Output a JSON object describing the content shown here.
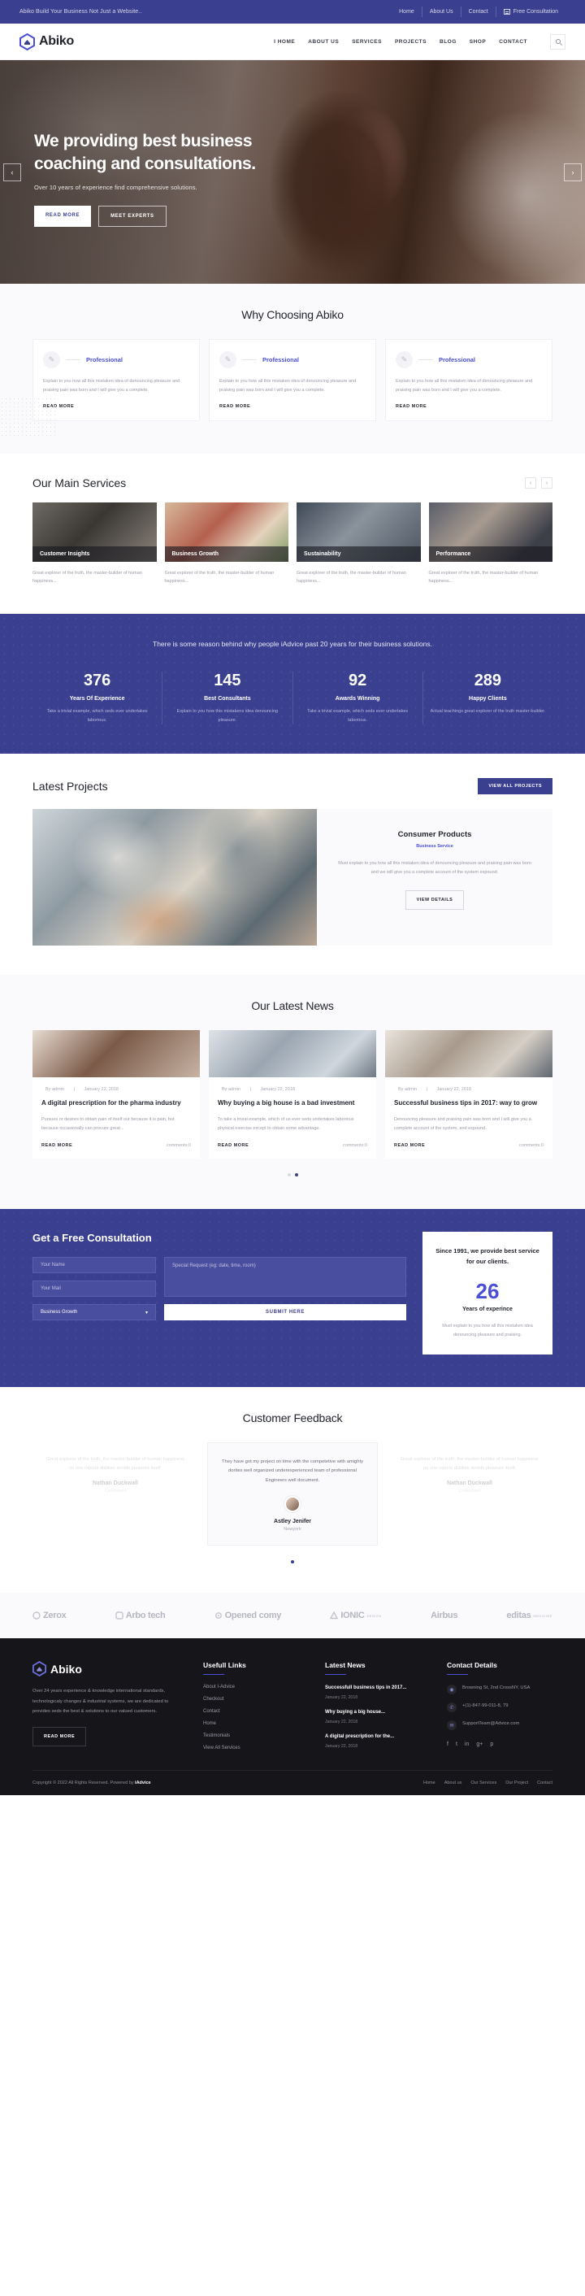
{
  "topbar": {
    "tagline": "Abiko Build Your Business Not Just a Website..",
    "links": [
      "Home",
      "About Us",
      "Contact"
    ],
    "cta": "Free Consultation"
  },
  "header": {
    "brand": "Abiko",
    "nav": [
      "I HOME",
      "ABOUT US",
      "SERVICES",
      "PROJECTS",
      "BLOG",
      "SHOP",
      "CONTACT"
    ],
    "search_icon": "search-icon"
  },
  "hero": {
    "title": "We providing best business coaching and consultations.",
    "subtitle": "Over 10 years of experience find comprehensive solutions.",
    "btn_primary": "READ MORE",
    "btn_secondary": "MEET EXPERTS",
    "arrow_prev": "‹",
    "arrow_next": "›"
  },
  "why": {
    "heading": "Why Choosing Abiko",
    "cards": [
      {
        "title": "Professional",
        "body": "Explain to you how all this mistaken idea of denouncing pleasure and praising pain was born and I will give you a complete.",
        "more": "READ MORE"
      },
      {
        "title": "Professional",
        "body": "Explain to you how all this mistaken idea of denouncing pleasure and praising pain was born and I will give you a complete.",
        "more": "READ MORE"
      },
      {
        "title": "Professional",
        "body": "Explain to you how all this mistaken idea of denouncing pleasure and praising pain was born and I will give you a complete.",
        "more": "READ MORE"
      }
    ]
  },
  "services": {
    "heading": "Our Main Services",
    "prev": "‹",
    "next": "›",
    "items": [
      {
        "title": "Customer Insights",
        "text": "Great explorer of the truth, the master-builder of human happiness..."
      },
      {
        "title": "Business Growth",
        "text": "Great explorer of the truth, the master-builder of human happiness..."
      },
      {
        "title": "Sustainability",
        "text": "Great explorer of the truth, the master-builder of human happiness..."
      },
      {
        "title": "Performance",
        "text": "Great explorer of the truth, the master-builder of human happiness..."
      }
    ]
  },
  "stats": {
    "lead": "There is some reason behind why people iAdvice past 20 years for their business solutions.",
    "items": [
      {
        "num": "376",
        "label": "Years Of Experience",
        "desc": "Take a trivial example, which seds ever undertakes laborious."
      },
      {
        "num": "145",
        "label": "Best Consultants",
        "desc": "Explain to you how this mistakens idea denouncing pleasure."
      },
      {
        "num": "92",
        "label": "Awards Winning",
        "desc": "Take a trivial example, which seds ever undertakes laborious."
      },
      {
        "num": "289",
        "label": "Happy Clients",
        "desc": "Actual teachings great explorer of the truth master-builder."
      }
    ]
  },
  "projects": {
    "heading": "Latest Projects",
    "view_all": "VIEW ALL PROJECTS",
    "title": "Consumer Products",
    "category": "Business Service",
    "desc": "Must explain to you how all this mistaken idea of denouncing pleasure and praising pain was born and we will give you a complete account of the system expound.",
    "view_details": "VIEW DETAILS"
  },
  "news": {
    "heading": "Our Latest News",
    "items": [
      {
        "author": "By admin",
        "date": "January 22, 2018",
        "title": "A digital prescription for the pharma industry",
        "desc": "Pursues or desires to obtain pain of itself our because it is pain, but because occasionally can procure great ..",
        "more": "READ MORE",
        "comments": "comments:0"
      },
      {
        "author": "By admin",
        "date": "January 22, 2018",
        "title": "Why buying a big house is a bad investment",
        "desc": "To take a trivial example, which of us ever seds undertakes laborious physical exercise except to obtain some advantage.",
        "more": "READ MORE",
        "comments": "comments:0"
      },
      {
        "author": "By admin",
        "date": "January 22, 2018",
        "title": "Successful business tips in 2017: way to grow",
        "desc": "Denouncing pleasure and praising pain was born and I will give you a complete account of the system, and expound.",
        "more": "READ MORE",
        "comments": "comments:0"
      }
    ],
    "dots": [
      "",
      ""
    ],
    "active_dot": 1
  },
  "consultation": {
    "heading": "Get a Free Consultation",
    "name_placeholder": "Your Name",
    "mail_placeholder": "Your Mail",
    "request_placeholder": "Special Request (eg: date, time, room)",
    "select_value": "Business Growth",
    "submit": "SUBMIT HERE",
    "card_title": "Since 1991, we provide best service for our clients.",
    "card_number": "26",
    "card_number_label": "Years of experince",
    "card_desc": "Must explain to you how all this mistaken idea denouncing pleasure and praising."
  },
  "feedback": {
    "heading": "Customer Feedback",
    "items": [
      {
        "text": "Great explorer of the truth, the master-builder of human happiness no one rejects dislikes avoids pleasure itself.",
        "name": "Nathan Duckwall",
        "role": "Consultant"
      },
      {
        "text": "They have got my project on time with the competetive with amighty dorites well organized underexperienced team of professional Engineers well document.",
        "name": "Astley Jenifer",
        "role": "Newyork"
      },
      {
        "text": "Great explorer of the truth, the master-builder of human happiness no one rejects dislikes avoids pleasure itself.",
        "name": "Nathan Duckwall",
        "role": "Consultant"
      }
    ],
    "active_dot": 0
  },
  "brands": [
    {
      "name": "Zerox",
      "sub": ""
    },
    {
      "name": "Arbo tech",
      "sub": ""
    },
    {
      "name": "Opened comy",
      "sub": ""
    },
    {
      "name": "IONIC",
      "sub": "DESIGN"
    },
    {
      "name": "Airbus",
      "sub": ""
    },
    {
      "name": "editas",
      "sub": "MEDICINE"
    }
  ],
  "footer": {
    "brand": "Abiko",
    "about": "Over 24 years experience & knowledge international standards, technologicaly changes & industrial systems, we are dedicated to provides seds the best & solutions to our valued customers.",
    "read_more": "READ MORE",
    "links_title": "Usefull Links",
    "links": [
      "About I-Advice",
      "Checkout",
      "Contact",
      "Home",
      "Testimonials",
      "View All Services"
    ],
    "news_title": "Latest News",
    "news": [
      {
        "title": "Successfull business tips in 2017...",
        "date": "January 22, 2018"
      },
      {
        "title": "Why buying a big house...",
        "date": "January 22, 2018"
      },
      {
        "title": "A digital prescription for the...",
        "date": "January 22, 2018"
      }
    ],
    "contact_title": "Contact Details",
    "contact": [
      {
        "icon": "location-icon",
        "glyph": "◉",
        "text": "Browning St, 2nd CrossNY, USA"
      },
      {
        "icon": "phone-icon",
        "glyph": "✆",
        "text": "+(1)-847-99-011-8, 79"
      },
      {
        "icon": "mail-icon",
        "glyph": "✉",
        "text": "SupportTeam@Advice.com"
      }
    ],
    "social": [
      "f",
      "t",
      "in",
      "g+",
      "p"
    ],
    "copyright_prefix": "Copyright © 2022 All Rights Reserved. Powered by ",
    "copyright_brand": "iAdvice",
    "bottom_nav": [
      "Home",
      "About us",
      "Our Services",
      "Our Project",
      "Contact"
    ]
  },
  "colors": {
    "brand": "#3b3f8f",
    "accent": "#4b4fd6",
    "dark": "#16161a"
  }
}
